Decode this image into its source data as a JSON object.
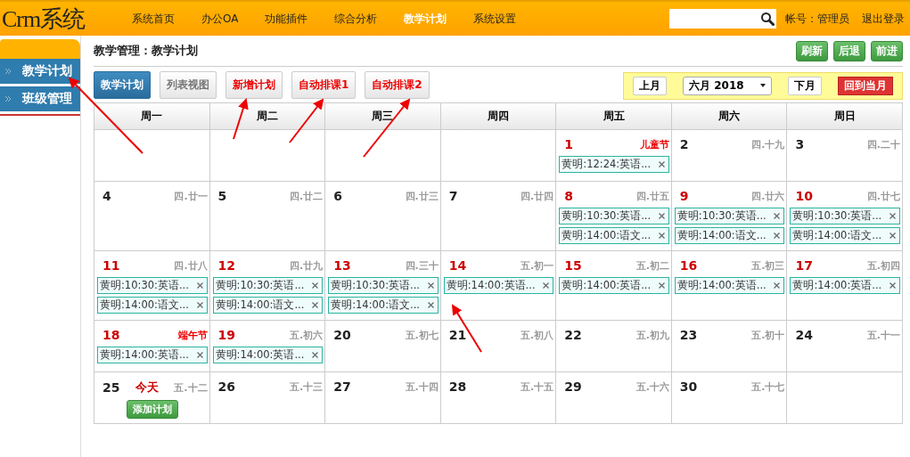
{
  "header": {
    "logo": "Crm系统",
    "nav": [
      {
        "label": "系统首页",
        "selected": false
      },
      {
        "label": "办公OA",
        "selected": false
      },
      {
        "label": "功能插件",
        "selected": false
      },
      {
        "label": "综合分析",
        "selected": false
      },
      {
        "label": "教学计划",
        "selected": true
      },
      {
        "label": "系统设置",
        "selected": false
      }
    ],
    "account_label": "帐号：",
    "account_name": "管理员",
    "logout": "退出登录"
  },
  "sidebar": {
    "items": [
      {
        "label": "教学计划"
      },
      {
        "label": "班级管理"
      }
    ]
  },
  "breadcrumb": "教学管理：教学计划",
  "page_buttons": [
    "刷新",
    "后退",
    "前进"
  ],
  "tabs": [
    {
      "label": "教学计划",
      "kind": "view",
      "selected": true
    },
    {
      "label": "列表视图",
      "kind": "view",
      "selected": false
    },
    {
      "label": "新增计划",
      "kind": "action",
      "selected": false
    },
    {
      "label": "自动排课1",
      "kind": "action",
      "selected": false
    },
    {
      "label": "自动排课2",
      "kind": "action",
      "selected": false
    }
  ],
  "month_nav": {
    "prev": "上月",
    "month": "六月 2018",
    "next": "下月",
    "today": "回到当月"
  },
  "weekdays": [
    "周一",
    "周二",
    "周三",
    "周四",
    "周五",
    "周六",
    "周日"
  ],
  "weeks": [
    [
      {
        "kind": "blank"
      },
      {
        "kind": "blank"
      },
      {
        "kind": "blank"
      },
      {
        "kind": "blank"
      },
      {
        "kind": "day",
        "day": "1",
        "lunar": "儿童节",
        "holiday": true,
        "events": [
          "黄明:12:24:英语..."
        ]
      },
      {
        "kind": "day",
        "day": "2",
        "lunar": "四.十九",
        "holiday": false
      },
      {
        "kind": "day",
        "day": "3",
        "lunar": "四.二十",
        "holiday": false
      }
    ],
    [
      {
        "kind": "day",
        "day": "4",
        "lunar": "四.廿一",
        "holiday": false
      },
      {
        "kind": "day",
        "day": "5",
        "lunar": "四.廿二",
        "holiday": false
      },
      {
        "kind": "day",
        "day": "6",
        "lunar": "四.廿三",
        "holiday": false
      },
      {
        "kind": "day",
        "day": "7",
        "lunar": "四.廿四",
        "holiday": false
      },
      {
        "kind": "day",
        "day": "8",
        "lunar": "四.廿五",
        "holiday": false,
        "events": [
          "黄明:10:30:英语...",
          "黄明:14:00:语文..."
        ]
      },
      {
        "kind": "day",
        "day": "9",
        "lunar": "四.廿六",
        "holiday": false,
        "events": [
          "黄明:10:30:英语...",
          "黄明:14:00:语文..."
        ]
      },
      {
        "kind": "day",
        "day": "10",
        "lunar": "四.廿七",
        "holiday": false,
        "events": [
          "黄明:10:30:英语...",
          "黄明:14:00:语文..."
        ]
      }
    ],
    [
      {
        "kind": "day",
        "day": "11",
        "lunar": "四.廿八",
        "holiday": false,
        "events": [
          "黄明:10:30:英语...",
          "黄明:14:00:语文..."
        ]
      },
      {
        "kind": "day",
        "day": "12",
        "lunar": "四.廿九",
        "holiday": false,
        "events": [
          "黄明:10:30:英语...",
          "黄明:14:00:语文..."
        ]
      },
      {
        "kind": "day",
        "day": "13",
        "lunar": "四.三十",
        "holiday": false,
        "events": [
          "黄明:10:30:英语...",
          "黄明:14:00:语文..."
        ]
      },
      {
        "kind": "day",
        "day": "14",
        "lunar": "五.初一",
        "holiday": false,
        "events": [
          "黄明:14:00:英语..."
        ]
      },
      {
        "kind": "day",
        "day": "15",
        "lunar": "五.初二",
        "holiday": false,
        "events": [
          "黄明:14:00:英语..."
        ]
      },
      {
        "kind": "day",
        "day": "16",
        "lunar": "五.初三",
        "holiday": false,
        "events": [
          "黄明:14:00:英语..."
        ]
      },
      {
        "kind": "day",
        "day": "17",
        "lunar": "五.初四",
        "holiday": false,
        "events": [
          "黄明:14:00:英语..."
        ]
      }
    ],
    [
      {
        "kind": "day",
        "day": "18",
        "lunar": "端午节",
        "holiday": true,
        "events": [
          "黄明:14:00:英语..."
        ]
      },
      {
        "kind": "day",
        "day": "19",
        "lunar": "五.初六",
        "holiday": false,
        "events": [
          "黄明:14:00:英语..."
        ]
      },
      {
        "kind": "day",
        "day": "20",
        "lunar": "五.初七",
        "holiday": false
      },
      {
        "kind": "day",
        "day": "21",
        "lunar": "五.初八",
        "holiday": false
      },
      {
        "kind": "day",
        "day": "22",
        "lunar": "五.初九",
        "holiday": false
      },
      {
        "kind": "day",
        "day": "23",
        "lunar": "五.初十",
        "holiday": false
      },
      {
        "kind": "day",
        "day": "24",
        "lunar": "五.十一",
        "holiday": false
      }
    ],
    [
      {
        "kind": "day",
        "day": "25",
        "today_label": "今天",
        "lunar": "五.十二",
        "holiday": false,
        "add_button": "添加计划"
      },
      {
        "kind": "day",
        "day": "26",
        "lunar": "五.十三",
        "holiday": false
      },
      {
        "kind": "day",
        "day": "27",
        "lunar": "五.十四",
        "holiday": false
      },
      {
        "kind": "day",
        "day": "28",
        "lunar": "五.十五",
        "holiday": false
      },
      {
        "kind": "day",
        "day": "29",
        "lunar": "五.十六",
        "holiday": false
      },
      {
        "kind": "day",
        "day": "30",
        "lunar": "五.十七",
        "holiday": false
      },
      {
        "kind": "blank"
      }
    ]
  ]
}
